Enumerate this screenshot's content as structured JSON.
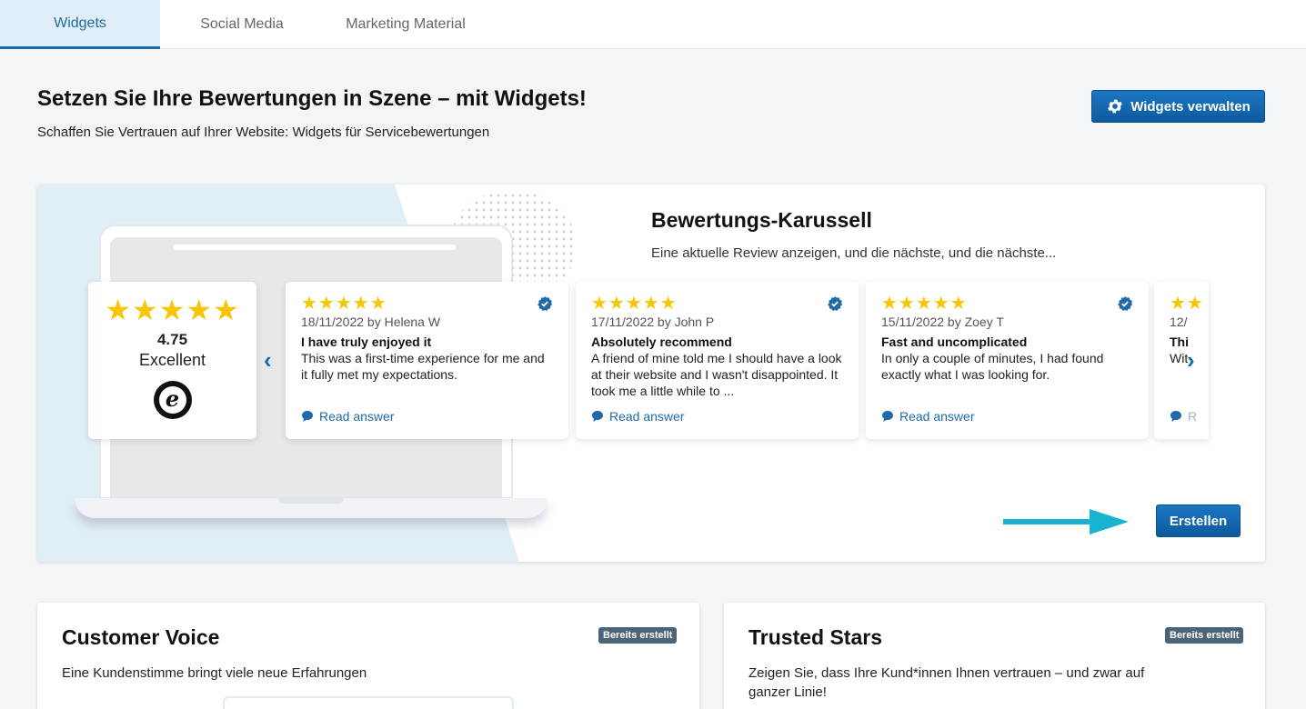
{
  "tabs": [
    {
      "label": "Widgets",
      "active": true
    },
    {
      "label": "Social Media",
      "active": false
    },
    {
      "label": "Marketing Material",
      "active": false
    }
  ],
  "header": {
    "title": "Setzen Sie Ihre Bewertungen in Szene – mit Widgets!",
    "subtitle": "Schaffen Sie Vertrauen auf Ihrer Website: Widgets für Servicebewertungen",
    "manage_button": "Widgets verwalten",
    "manage_icon": "gear-icon"
  },
  "hero": {
    "title": "Bewertungs-Karussell",
    "subtitle": "Eine aktuelle Review anzeigen, und die nächste, und die nächste...",
    "create_button": "Erstellen",
    "rating": {
      "stars": "★★★★★",
      "score": "4.75",
      "label": "Excellent",
      "logo": "e"
    },
    "nav_prev": "‹",
    "nav_next": "›",
    "reviews": [
      {
        "stars": "★★★★★",
        "meta": "18/11/2022 by Helena W",
        "title": "I have truly enjoyed it",
        "text": "This was a first-time experience for me and it fully met my expectations.",
        "link": "Read answer"
      },
      {
        "stars": "★★★★★",
        "meta": "17/11/2022 by John P",
        "title": "Absolutely recommend",
        "text": "A friend of mine told me I should have a look at their website and I wasn't disappointed. It took me a little while to ...",
        "link": "Read answer"
      },
      {
        "stars": "★★★★★",
        "meta": "15/11/2022 by Zoey T",
        "title": "Fast and uncomplicated",
        "text": "In only a couple of minutes, I had found exactly what I was looking for.",
        "link": "Read answer"
      }
    ],
    "partial": {
      "stars": "★★",
      "meta": "12/",
      "title": "Thi",
      "text": "Wit",
      "link": "R"
    }
  },
  "cards": [
    {
      "title": "Customer Voice",
      "badge": "Bereits erstellt",
      "desc": "Eine Kundenstimme bringt viele neue Erfahrungen"
    },
    {
      "title": "Trusted Stars",
      "badge": "Bereits erstellt",
      "desc": "Zeigen Sie, dass Ihre Kund*innen Ihnen vertrauen – und zwar auf ganzer Linie!"
    }
  ],
  "colors": {
    "accent": "#1f6aa8",
    "star": "#f7c600",
    "badge": "#4b6478",
    "arrow": "#17b3d1"
  }
}
